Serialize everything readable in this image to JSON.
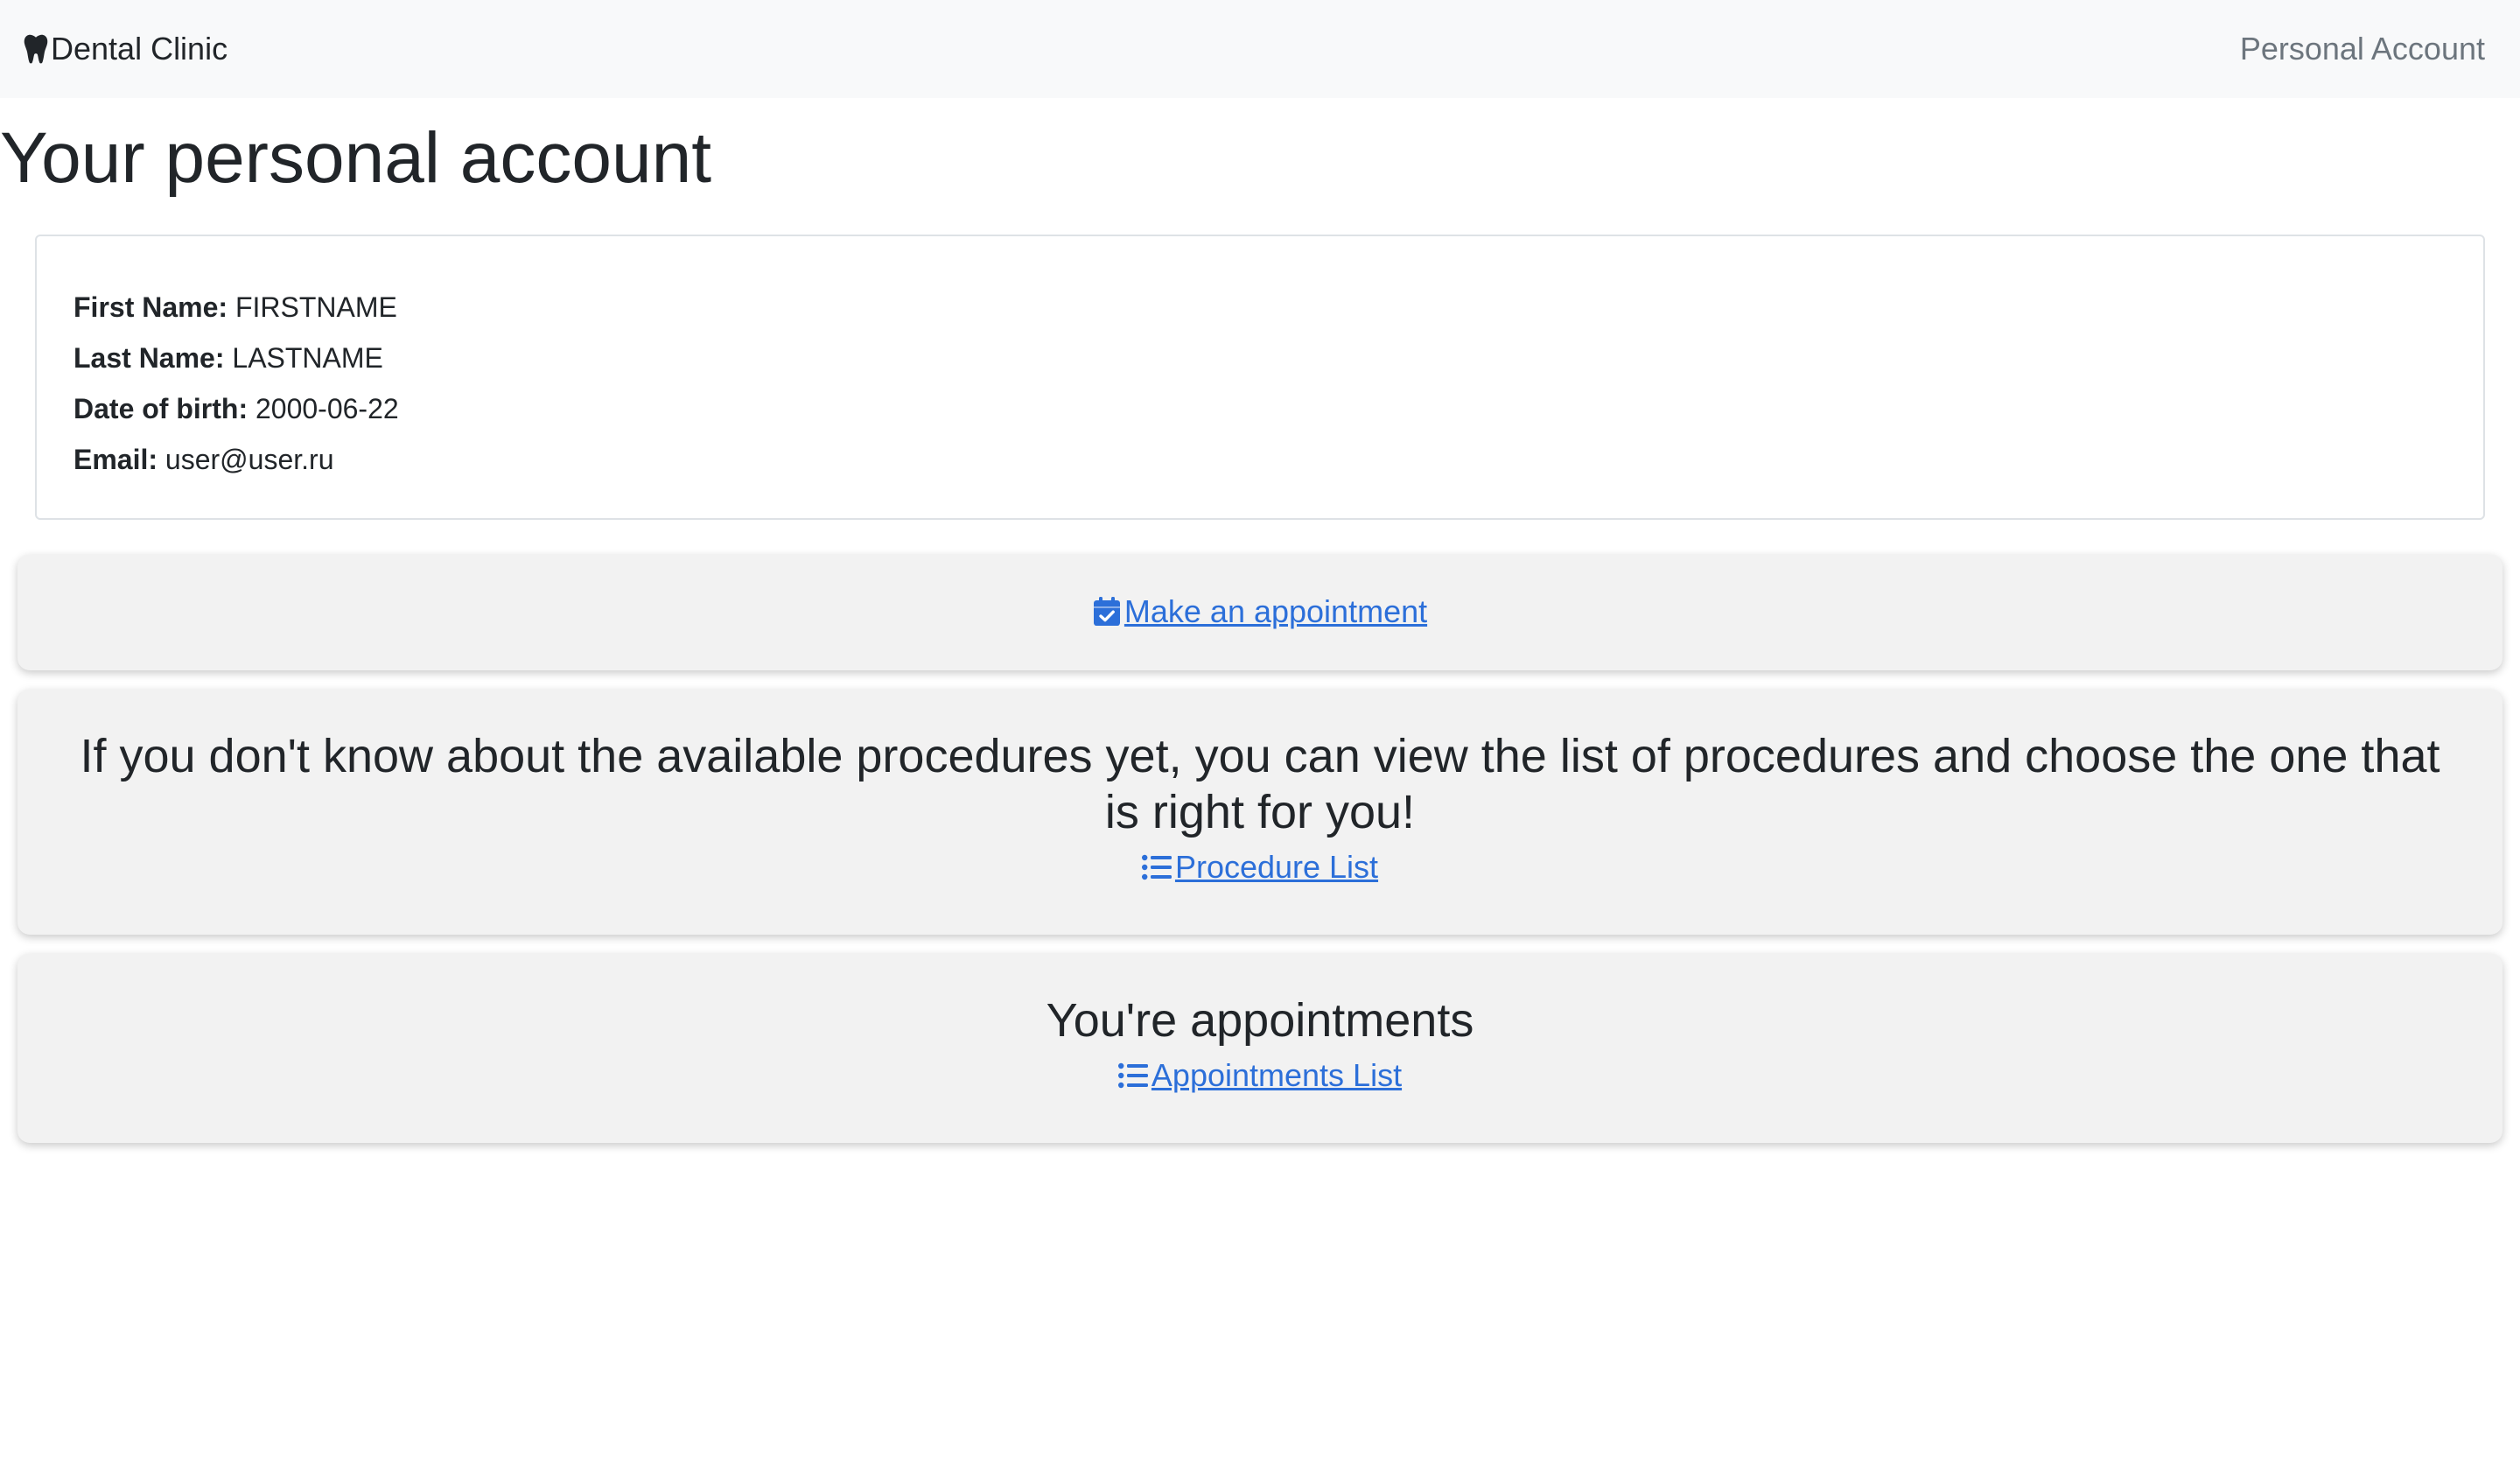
{
  "navbar": {
    "brand_label": "Dental Clinic",
    "brand_icon": "tooth-icon",
    "nav_link": "Personal Account"
  },
  "page": {
    "title": "Your personal account"
  },
  "profile": {
    "first_name_label": "First Name:",
    "first_name_value": "FIRSTNAME",
    "last_name_label": "Last Name:",
    "last_name_value": "LASTNAME",
    "dob_label": "Date of birth:",
    "dob_value": "2000-06-22",
    "email_label": "Email:",
    "email_value": "user@user.ru"
  },
  "appointment_card": {
    "link_label": "Make an appointment",
    "icon": "calendar-check-icon"
  },
  "procedures_card": {
    "heading": "If you don't know about the available procedures yet, you can view the list of procedures and choose the one that is right for you!",
    "link_label": "Procedure List",
    "icon": "list-icon"
  },
  "appointments_card": {
    "heading": "You're appointments",
    "link_label": "Appointments List",
    "icon": "list-icon"
  },
  "colors": {
    "link": "#2c6fd9",
    "navbar_bg": "#f8f9fa",
    "card_bg": "#f2f2f2",
    "muted_text": "#6c757d"
  }
}
